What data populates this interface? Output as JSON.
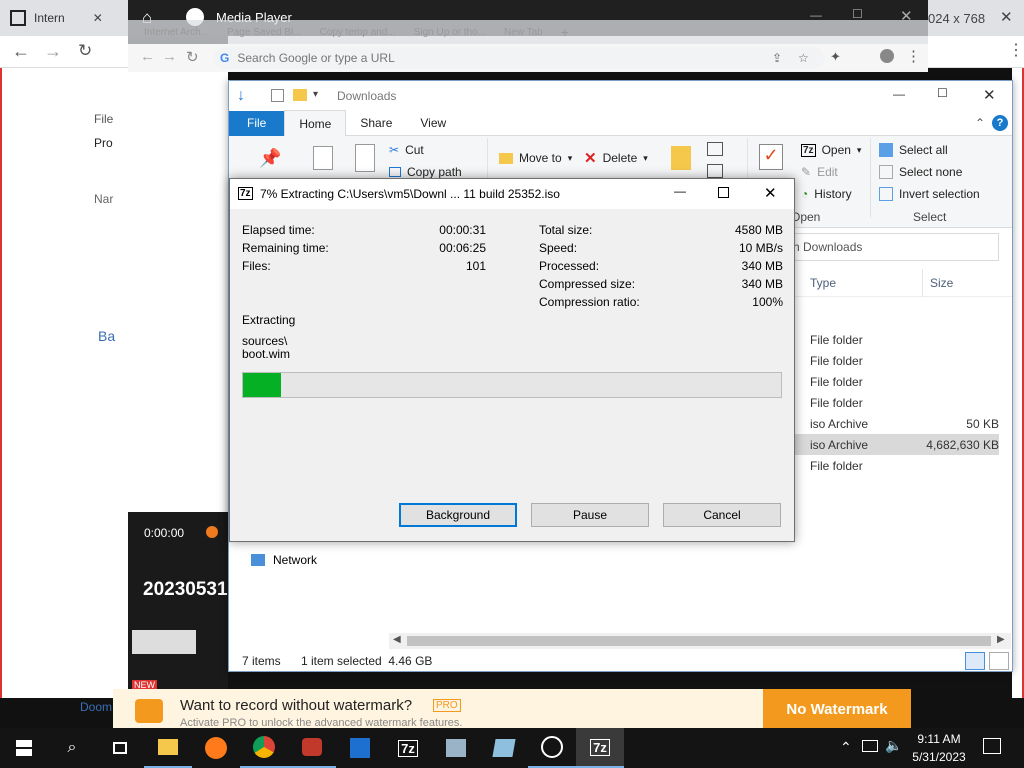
{
  "colors": {
    "accent": "#0078d7",
    "progress": "#06b025",
    "brand_orange": "#f39a1e",
    "taskbar": "#141414"
  },
  "browser": {
    "tab_title": "Intern",
    "resolution_text": "024 x 768",
    "sidebar_labels": {
      "file": "File",
      "pro": "Pro",
      "nam": "Nar",
      "ba": "Ba"
    },
    "doom_texts": [
      "Doom",
      "Doom"
    ]
  },
  "media_player": {
    "title": "Media Player",
    "time": "0:00:00",
    "video_title": "20230531",
    "badge_new": "NEW"
  },
  "chrome": {
    "tabs": [
      "Internet Arch...",
      "Page Saved Bl...",
      "Copy temp and...",
      "Sign Up or tho...",
      "New Tab"
    ],
    "omnibox_placeholder": "Search Google or type a URL"
  },
  "explorer": {
    "title": "Downloads",
    "tabs": [
      "File",
      "Home",
      "Share",
      "View"
    ],
    "ribbon": {
      "cut": "Cut",
      "copy_path": "Copy path",
      "move_to": "Move to",
      "delete": "Delete",
      "open": "Open",
      "edit": "Edit",
      "history": "History",
      "open_group": "Open",
      "select_all": "Select all",
      "select_none": "Select none",
      "invert_selection": "Invert selection",
      "select_group": "Select"
    },
    "address": "h Downloads",
    "columns": {
      "type": "Type",
      "size": "Size"
    },
    "rows": [
      {
        "type": "File folder",
        "size": ""
      },
      {
        "type": "File folder",
        "size": ""
      },
      {
        "type": "File folder",
        "size": ""
      },
      {
        "type": "File folder",
        "size": ""
      },
      {
        "type": "iso Archive",
        "size": "50 KB"
      },
      {
        "type": "iso Archive",
        "size": "4,682,630 KB"
      },
      {
        "type": "File folder",
        "size": ""
      }
    ],
    "network_label": "Network",
    "status": {
      "items": "7 items",
      "selected": "1 item selected  4.46 GB"
    }
  },
  "zip": {
    "title": "7% Extracting C:\\Users\\vm5\\Downl ... 11 build 25352.iso",
    "left": [
      {
        "k": "Elapsed time:",
        "v": "00:00:31"
      },
      {
        "k": "Remaining time:",
        "v": "00:06:25"
      },
      {
        "k": "Files:",
        "v": "101"
      }
    ],
    "right": [
      {
        "k": "Total size:",
        "v": "4580 MB"
      },
      {
        "k": "Speed:",
        "v": "10 MB/s"
      },
      {
        "k": "Processed:",
        "v": "340 MB"
      },
      {
        "k": "Compressed size:",
        "v": "340 MB"
      },
      {
        "k": "Compression ratio:",
        "v": "100%"
      }
    ],
    "extracting_label": "Extracting",
    "path_line1": "sources\\",
    "path_line2": "boot.wim",
    "progress": 0.07,
    "buttons": {
      "background": "Background",
      "pause": "Pause",
      "cancel": "Cancel"
    }
  },
  "banner": {
    "headline": "Want to record without watermark?",
    "pro_badge": "PRO",
    "sub": "Activate PRO to unlock the advanced watermark features.",
    "cta": "No Watermark"
  },
  "taskbar": {
    "icons": [
      "windows-start-icon",
      "search-icon",
      "task-view-icon",
      "file-explorer-icon",
      "firefox-icon",
      "chrome-icon",
      "screen-recorder-icon",
      "media-player-app-icon",
      "seven-zip-icon",
      "network-app-icon",
      "notepad-icon",
      "media-player-icon",
      "seven-zip-active-icon"
    ],
    "time": "9:11 AM",
    "date": "5/31/2023"
  }
}
